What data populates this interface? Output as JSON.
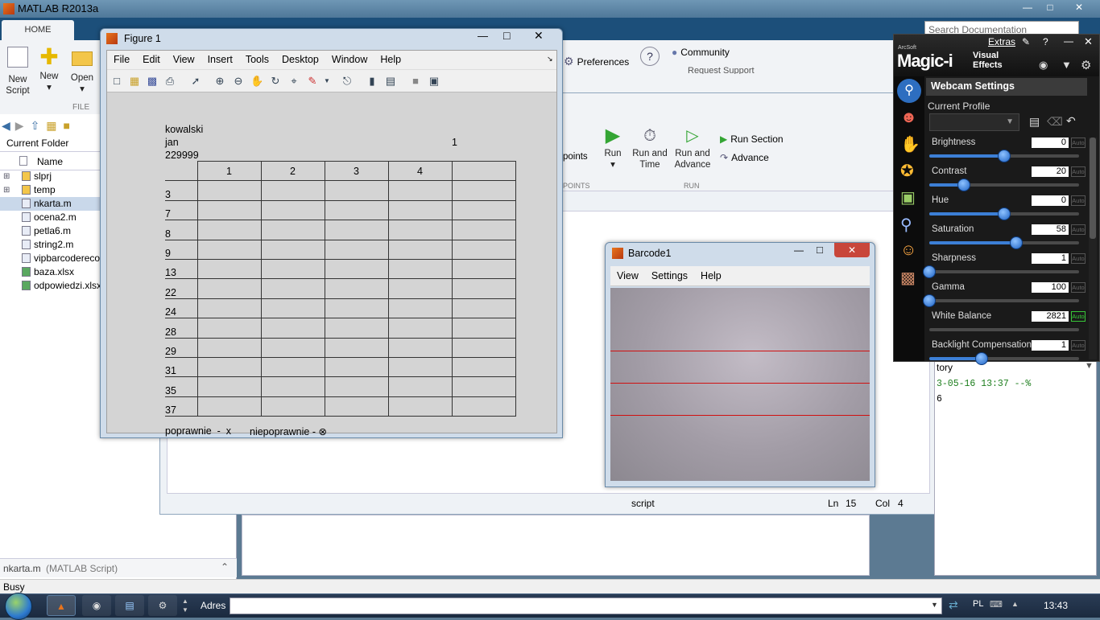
{
  "matlab": {
    "title": "MATLAB R2013a",
    "home_tab": "HOME",
    "new_script": [
      "New",
      "Script"
    ],
    "new": "New",
    "open": "Open",
    "file_section": "FILE",
    "search_placeholder": "Search Documentation",
    "preferences": "Preferences",
    "community": "Community",
    "request_support": "Request Support",
    "current_folder": "Current Folder",
    "name_col": "Name",
    "files": [
      "slprj",
      "temp",
      "nkarta.m",
      "ocena2.m",
      "petla6.m",
      "string2.m",
      "vipbarcodereco",
      "baza.xlsx",
      "odpowiedzi.xlsx"
    ],
    "details": {
      "name": "nkarta.m",
      "type": "(MATLAB Script)"
    },
    "status": "Busy",
    "editor": {
      "breakpoints": "points",
      "breakpoints_section": "POINTS",
      "run": "Run",
      "run_and_time": [
        "Run and",
        "Time"
      ],
      "run_and_advance": [
        "Run and",
        "Advance"
      ],
      "run_section": "Run Section",
      "advance": "Advance",
      "run_group": "RUN",
      "status_type": "script",
      "ln_label": "Ln",
      "ln": "15",
      "col_label": "Col",
      "col": "4"
    },
    "history": {
      "title": "tory",
      "line1": "3-05-16 13:37 --%",
      "line2": "6"
    }
  },
  "figure": {
    "title": "Figure 1",
    "menu": [
      "File",
      "Edit",
      "View",
      "Insert",
      "Tools",
      "Desktop",
      "Window",
      "Help"
    ],
    "surname": "kowalski",
    "firstname": "jan",
    "id": "229999",
    "variant": "1",
    "col_headers": [
      "1",
      "2",
      "3",
      "4",
      ""
    ],
    "row_labels": [
      "3",
      "7",
      "8",
      "9",
      "13",
      "22",
      "24",
      "28",
      "29",
      "31",
      "35",
      "37"
    ],
    "legend_correct": "poprawnie  -  x",
    "legend_incorrect": "niepoprawnie - ⊗"
  },
  "barcode": {
    "title": "Barcode1",
    "menu": [
      "View",
      "Settings",
      "Help"
    ]
  },
  "magic": {
    "brand_small": "ArcSoft",
    "brand": "Magic-i",
    "brand_sub1": "Visual",
    "brand_sub2": "Effects",
    "extras": "Extras",
    "panel_title": "Webcam Settings",
    "current_profile": "Current Profile",
    "auto": "Auto",
    "settings": [
      {
        "label": "Brightness",
        "value": "0",
        "level": 0.5,
        "auto": false
      },
      {
        "label": "Contrast",
        "value": "20",
        "level": 0.23,
        "auto": false
      },
      {
        "label": "Hue",
        "value": "0",
        "level": 0.5,
        "auto": false
      },
      {
        "label": "Saturation",
        "value": "58",
        "level": 0.58,
        "auto": false
      },
      {
        "label": "Sharpness",
        "value": "1",
        "level": 0.0,
        "auto": false
      },
      {
        "label": "Gamma",
        "value": "100",
        "level": 0.0,
        "auto": false
      },
      {
        "label": "White Balance",
        "value": "2821",
        "level": null,
        "auto": true
      },
      {
        "label": "Backlight Compensation",
        "value": "1",
        "level": 0.35,
        "auto": false
      }
    ]
  },
  "taskbar": {
    "address_label": "Adres",
    "lang": "PL",
    "clock": "13:43"
  },
  "colors": {
    "accent": "#1c4f7a",
    "slider": "#3c7fd6",
    "scanline": "#d01010"
  }
}
